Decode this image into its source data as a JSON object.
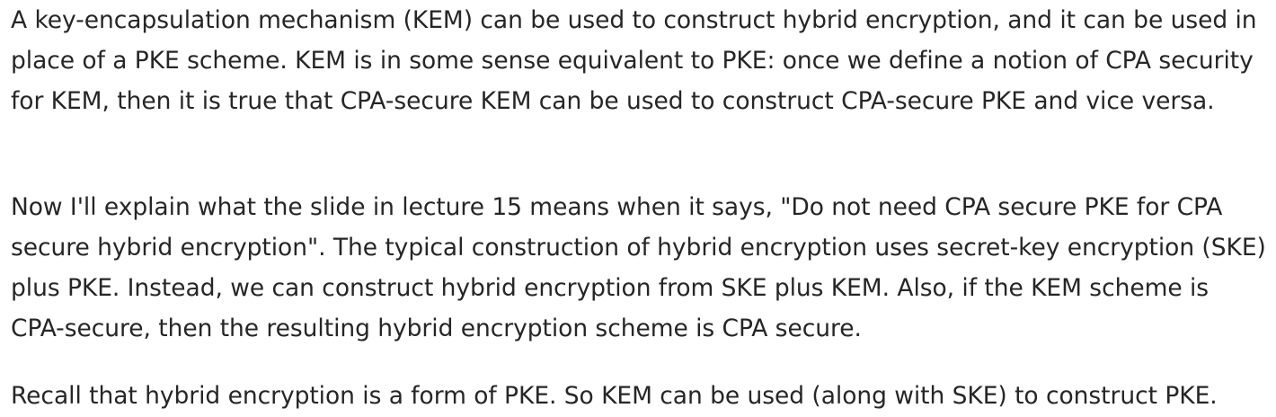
{
  "paragraphs": [
    "A key-encapsulation mechanism (KEM) can be used to construct hybrid encryption, and it can be used in place of a PKE scheme. KEM is in some sense equivalent to PKE: once we define a notion of CPA security for KEM, then it is true that CPA-secure KEM can be used to construct CPA-secure PKE and vice versa.",
    "Now I'll explain what the slide in lecture 15 means when it says, \"Do not need CPA secure PKE for CPA secure hybrid encryption\". The typical construction of hybrid encryption uses secret-key encryption (SKE) plus PKE. Instead, we can construct hybrid encryption from SKE plus KEM. Also, if the KEM scheme is CPA-secure, then the resulting hybrid encryption scheme is CPA secure.",
    "Recall that hybrid encryption is a form of PKE. So KEM can be used (along with SKE) to construct PKE."
  ]
}
